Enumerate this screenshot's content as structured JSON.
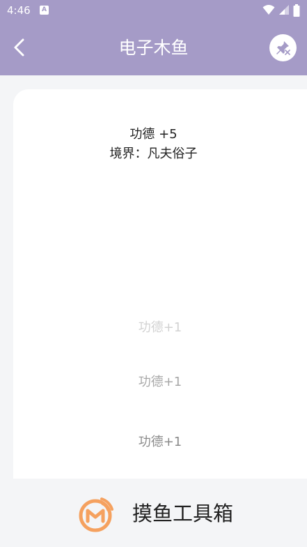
{
  "status_bar": {
    "time": "4:46",
    "app_icon_glyph": "A",
    "icons": [
      "wifi-icon",
      "signal-icon",
      "battery-icon"
    ]
  },
  "app_bar": {
    "title": "电子木鱼",
    "back_icon": "back-chevron-icon",
    "pin_icon": "unpin-icon",
    "background_color": "#a59bc7"
  },
  "main": {
    "merit_total": "功德 +5",
    "realm": "境界：凡夫俗子",
    "floating_merits": [
      "功德+1",
      "功德+1",
      "功德+1"
    ]
  },
  "footer": {
    "brand_text": "摸鱼工具箱",
    "logo_icon": "m-logo-icon",
    "logo_color": "#f5a15f"
  }
}
